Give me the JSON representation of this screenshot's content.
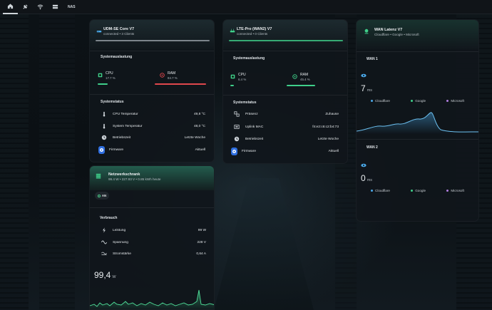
{
  "topbar": {
    "items": [
      {
        "icon": "home-icon"
      },
      {
        "icon": "satellite-icon"
      },
      {
        "icon": "wifi-icon"
      },
      {
        "icon": "server-icon"
      },
      {
        "label": "NAS"
      }
    ]
  },
  "udm": {
    "title": "UDM-SE Core V7",
    "subtitle": "connected • 3 Clients",
    "load_title": "Systemauslastung",
    "cpu": {
      "label": "CPU",
      "value": "17.7 %",
      "fill": 0.177
    },
    "ram": {
      "label": "RAM",
      "value": "84.7 %",
      "fill": 0.847
    },
    "status_title": "Systemstatus",
    "rows": [
      {
        "label": "CPU Temperatur",
        "value": "49,8 °C"
      },
      {
        "label": "System Temperatur",
        "value": "48,0 °C"
      },
      {
        "label": "Betriebszeit",
        "value": "Letzte Woche"
      },
      {
        "label": "Firmware",
        "value": "Aktuell"
      }
    ]
  },
  "lte": {
    "title": "LTE-Pro (WAN2) V7",
    "subtitle": "connected • 0 Clients",
    "load_title": "Systemauslastung",
    "cpu": {
      "label": "CPU",
      "value": "6.4 %",
      "fill": 0.064
    },
    "ram": {
      "label": "RAM",
      "value": "45.4 %",
      "fill": 0.454
    },
    "status_title": "Systemstatus",
    "rows": [
      {
        "label": "Präsenz",
        "value": "Zuhause"
      },
      {
        "label": "Uplink MAC",
        "value": "f4:e2:c6:c2:b4:73"
      },
      {
        "label": "Betriebszeit",
        "value": "Letzte Woche"
      },
      {
        "label": "Firmware",
        "value": "Aktuell"
      }
    ]
  },
  "wan": {
    "title": "WAN Latenz V7",
    "subtitle": "Cloudflare • Google • Microsoft",
    "wan1": {
      "label": "WAN 1",
      "value": "7",
      "unit": "ms"
    },
    "wan2": {
      "label": "WAN 2",
      "value": "0",
      "unit": "ms"
    },
    "legend": [
      {
        "name": "Cloudflare",
        "color": "#4aa8e8"
      },
      {
        "name": "Google",
        "color": "#3fcf8a"
      },
      {
        "name": "Microsoft",
        "color": "#b27ee0"
      }
    ]
  },
  "power": {
    "title": "Netzwerkschrank",
    "subtitle": "99.4 W • 227.93 V • 0.85 kWh heute",
    "toggle": "AN",
    "section": "Verbrauch",
    "rows": [
      {
        "label": "Leistung",
        "value": "99 W"
      },
      {
        "label": "Spannung",
        "value": "228 V"
      },
      {
        "label": "Stromstärke",
        "value": "0,64 A"
      }
    ],
    "big_value": "99,4",
    "big_unit": "W"
  },
  "colors": {
    "accent": "#3fcf8a",
    "ram_bar": "#e0474c",
    "cpu_bar": "#3fcf8a"
  }
}
